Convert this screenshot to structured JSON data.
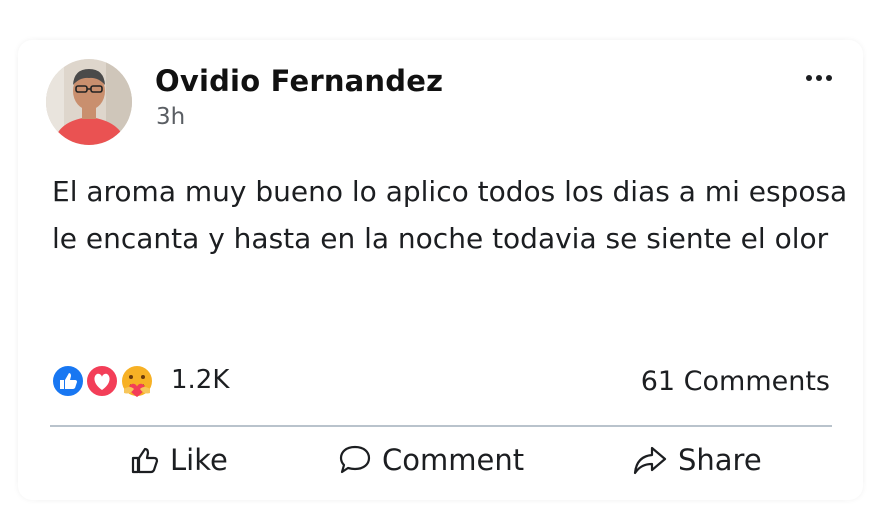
{
  "post": {
    "author": "Ovidio Fernandez",
    "time": "3h",
    "text": "El aroma muy bueno lo aplico todos los dias a mi esposa le encanta y hasta en la noche todavia se siente el olor"
  },
  "reactions": {
    "icons": [
      "like-icon",
      "love-icon",
      "care-icon"
    ],
    "count": "1.2K"
  },
  "comments_label": "61 Comments",
  "actions": {
    "like": "Like",
    "comment": "Comment",
    "share": "Share"
  },
  "colors": {
    "like_blue": "#1877f2",
    "love_red": "#f33e58",
    "care_yellow": "#f7b125",
    "divider": "#b9c3cc"
  }
}
